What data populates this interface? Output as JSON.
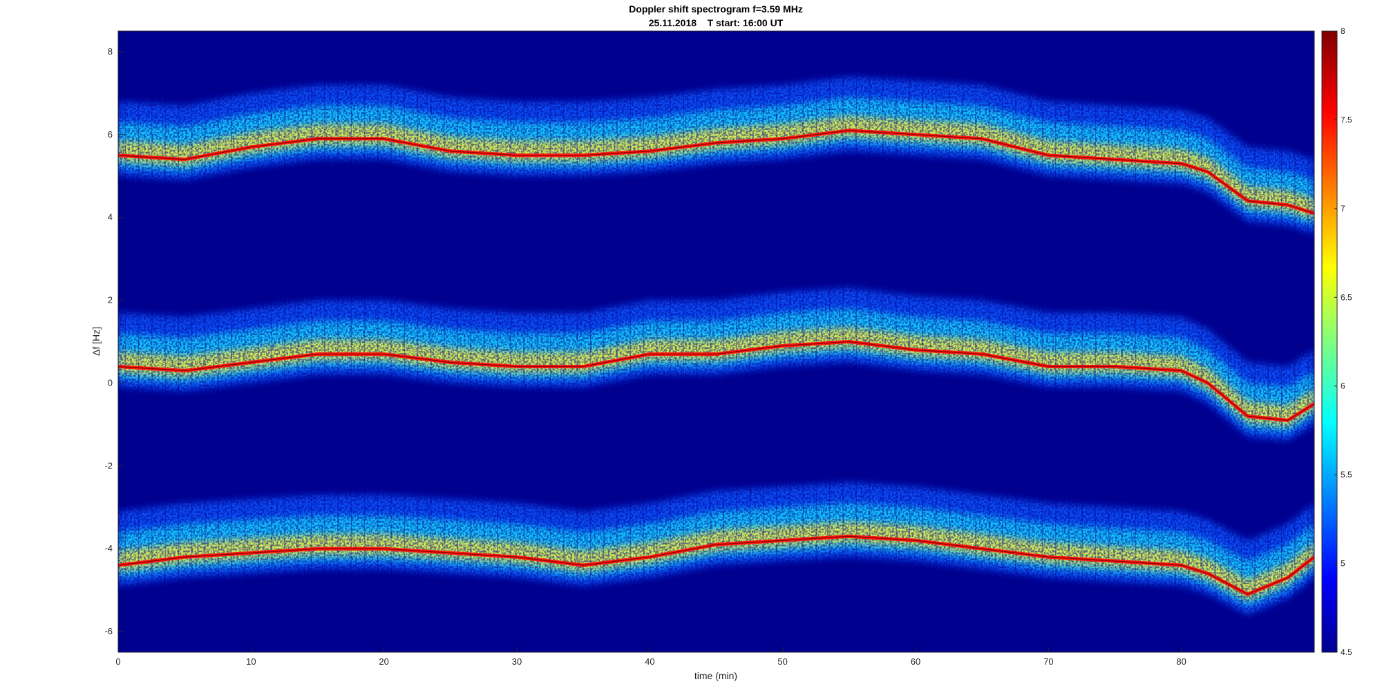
{
  "chart_data": {
    "type": "heatmap",
    "title": "Doppler shift spectrogram f=3.59 MHz",
    "subtitle": "25.11.2018    T start: 16:00 UT",
    "xlabel": "time (min)",
    "ylabel": "Δf [Hz]",
    "xlim": [
      0,
      90
    ],
    "ylim": [
      -6.5,
      8.5
    ],
    "x_ticks": [
      0,
      10,
      20,
      30,
      40,
      50,
      60,
      70,
      80
    ],
    "y_ticks": [
      8,
      6,
      4,
      2,
      0,
      -2,
      -4,
      -6
    ],
    "x_tick_labels": [
      "0",
      "10",
      "20",
      "30",
      "40",
      "50",
      "60",
      "70",
      "80"
    ],
    "y_tick_labels": [
      "8",
      "6",
      "4",
      "2",
      "0",
      "-2",
      "-4",
      "-6"
    ],
    "colorbar": {
      "range": [
        4.5,
        8
      ],
      "ticks": [
        8,
        7.5,
        7,
        6.5,
        6,
        5.5,
        5,
        4.5
      ],
      "tick_labels": [
        "8",
        "7.5",
        "7",
        "6.5",
        "6",
        "5.5",
        "5",
        "4.5"
      ],
      "colormap": "jet"
    },
    "grid": false,
    "legend": "none",
    "series": [
      {
        "x": [
          0,
          5,
          10,
          15,
          20,
          25,
          30,
          35,
          40,
          45,
          50,
          55,
          60,
          65,
          70,
          75,
          80,
          82,
          85,
          88,
          90
        ],
        "y": [
          5.5,
          5.4,
          5.7,
          5.9,
          5.9,
          5.6,
          5.5,
          5.5,
          5.6,
          5.8,
          5.9,
          6.1,
          6.0,
          5.9,
          5.5,
          5.4,
          5.3,
          5.1,
          4.4,
          4.3,
          4.1
        ]
      },
      {
        "x": [
          0,
          5,
          10,
          15,
          20,
          25,
          30,
          35,
          40,
          45,
          50,
          55,
          60,
          65,
          70,
          75,
          80,
          82,
          85,
          88,
          90
        ],
        "y": [
          0.4,
          0.3,
          0.5,
          0.7,
          0.7,
          0.5,
          0.4,
          0.4,
          0.7,
          0.7,
          0.9,
          1.0,
          0.8,
          0.7,
          0.4,
          0.4,
          0.3,
          0.0,
          -0.8,
          -0.9,
          -0.5
        ]
      },
      {
        "x": [
          0,
          5,
          10,
          15,
          20,
          25,
          30,
          35,
          40,
          45,
          50,
          55,
          60,
          65,
          70,
          75,
          80,
          82,
          85,
          88,
          90
        ],
        "y": [
          -4.4,
          -4.2,
          -4.1,
          -4.0,
          -4.0,
          -4.1,
          -4.2,
          -4.4,
          -4.2,
          -3.9,
          -3.8,
          -3.7,
          -3.8,
          -4.0,
          -4.2,
          -4.3,
          -4.4,
          -4.6,
          -5.1,
          -4.7,
          -4.2
        ]
      }
    ]
  }
}
